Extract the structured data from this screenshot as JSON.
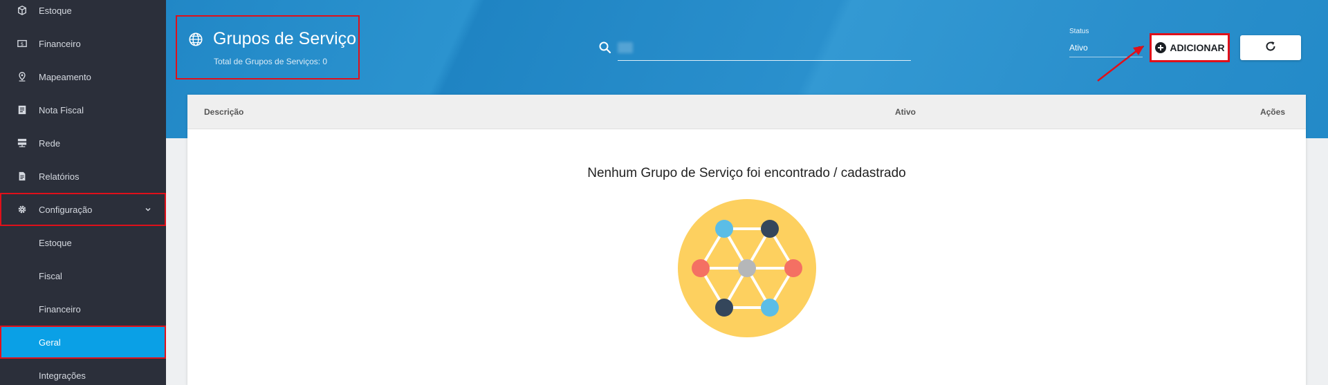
{
  "sidebar": {
    "items": [
      {
        "label": "Estoque",
        "icon": "box-icon"
      },
      {
        "label": "Financeiro",
        "icon": "money-icon"
      },
      {
        "label": "Mapeamento",
        "icon": "map-pin-icon"
      },
      {
        "label": "Nota Fiscal",
        "icon": "receipt-icon"
      },
      {
        "label": "Rede",
        "icon": "server-icon"
      },
      {
        "label": "Relatórios",
        "icon": "document-icon"
      },
      {
        "label": "Configuração",
        "icon": "gear-icon"
      }
    ],
    "subitems": [
      {
        "label": "Estoque"
      },
      {
        "label": "Fiscal"
      },
      {
        "label": "Financeiro"
      },
      {
        "label": "Geral",
        "active": true
      },
      {
        "label": "Integrações"
      }
    ]
  },
  "header": {
    "title": "Grupos de Serviço",
    "subtitle": "Total de Grupos de Serviços: 0",
    "search_value": ""
  },
  "status": {
    "label": "Status",
    "value": "Ativo"
  },
  "actions": {
    "add_label": "ADICIONAR"
  },
  "table": {
    "columns": [
      "Descrição",
      "Ativo",
      "Ações"
    ],
    "empty_message": "Nenhum Grupo de Serviço foi encontrado / cadastrado"
  },
  "colors": {
    "sidebar_bg": "#2b2f3a",
    "active_item": "#0aa0e6",
    "banner": "#2a8fcc",
    "highlight": "#e0101a",
    "illustration_bg": "#fdd05f"
  }
}
